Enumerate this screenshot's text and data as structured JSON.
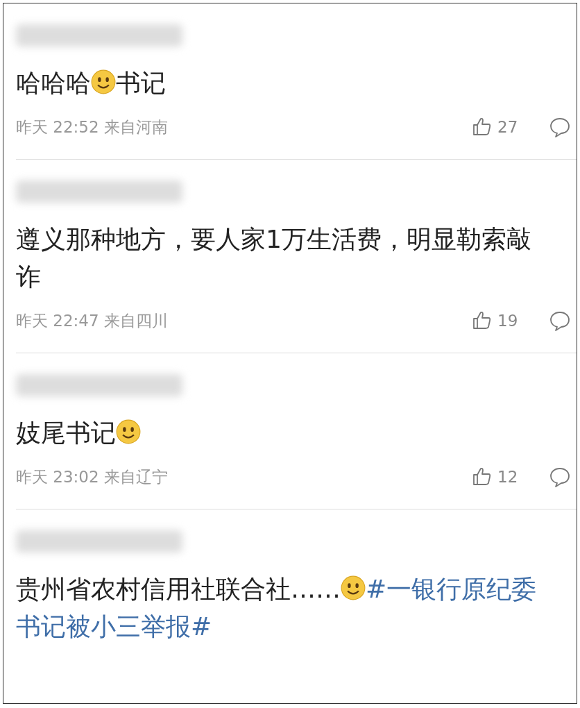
{
  "comments": [
    {
      "body": [
        {
          "kind": "text",
          "text": "哈哈哈"
        },
        {
          "kind": "emoji"
        },
        {
          "kind": "text",
          "text": "书记"
        }
      ],
      "time": "昨天 22:52 来自河南",
      "likes": "27"
    },
    {
      "body": [
        {
          "kind": "text",
          "text": "遵义那种地方，要人家1万生活费，明显勒索敲诈"
        }
      ],
      "time": "昨天 22:47 来自四川",
      "likes": "19"
    },
    {
      "body": [
        {
          "kind": "text",
          "text": "妓尾书记"
        },
        {
          "kind": "emoji"
        }
      ],
      "time": "昨天 23:02 来自辽宁",
      "likes": "12"
    },
    {
      "body": [
        {
          "kind": "text",
          "text": "贵州省农村信用社联合社……"
        },
        {
          "kind": "emoji"
        },
        {
          "kind": "hashtag",
          "text": "#一银行原纪委书记被小三举报#"
        }
      ]
    }
  ]
}
